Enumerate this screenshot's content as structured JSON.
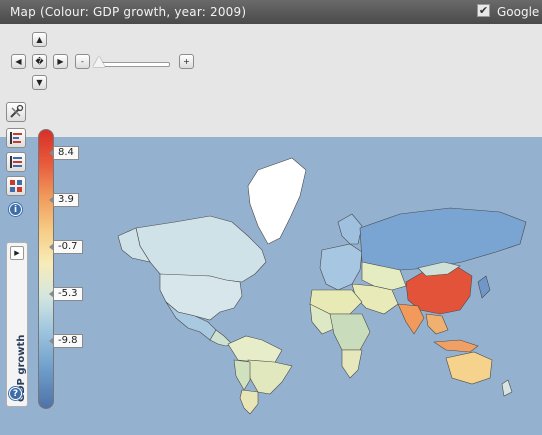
{
  "title": "Map (Colour: GDP growth, year: 2009)",
  "overlay_toggle": {
    "label": "Google",
    "checked": true
  },
  "navigation": {
    "up": "▲",
    "down": "▼",
    "left": "◀",
    "right": "▶",
    "center": "�",
    "zoom_out": "-",
    "zoom_in": "+"
  },
  "legend": {
    "title": "GDP growth",
    "ticks": [
      "8.4",
      "3.9",
      "-0.7",
      "-5.3",
      "-9.8"
    ],
    "colors": {
      "high": "#d73027",
      "mid": "#f7ecb8",
      "low": "#4f72a9"
    }
  },
  "play": {
    "symbol": "▶"
  },
  "info_icon": "i",
  "help_icon": "?",
  "colors": {
    "ocean": "#94b2d0",
    "panel": "#e6e6e6",
    "titlebar": "#4a4a4a"
  }
}
